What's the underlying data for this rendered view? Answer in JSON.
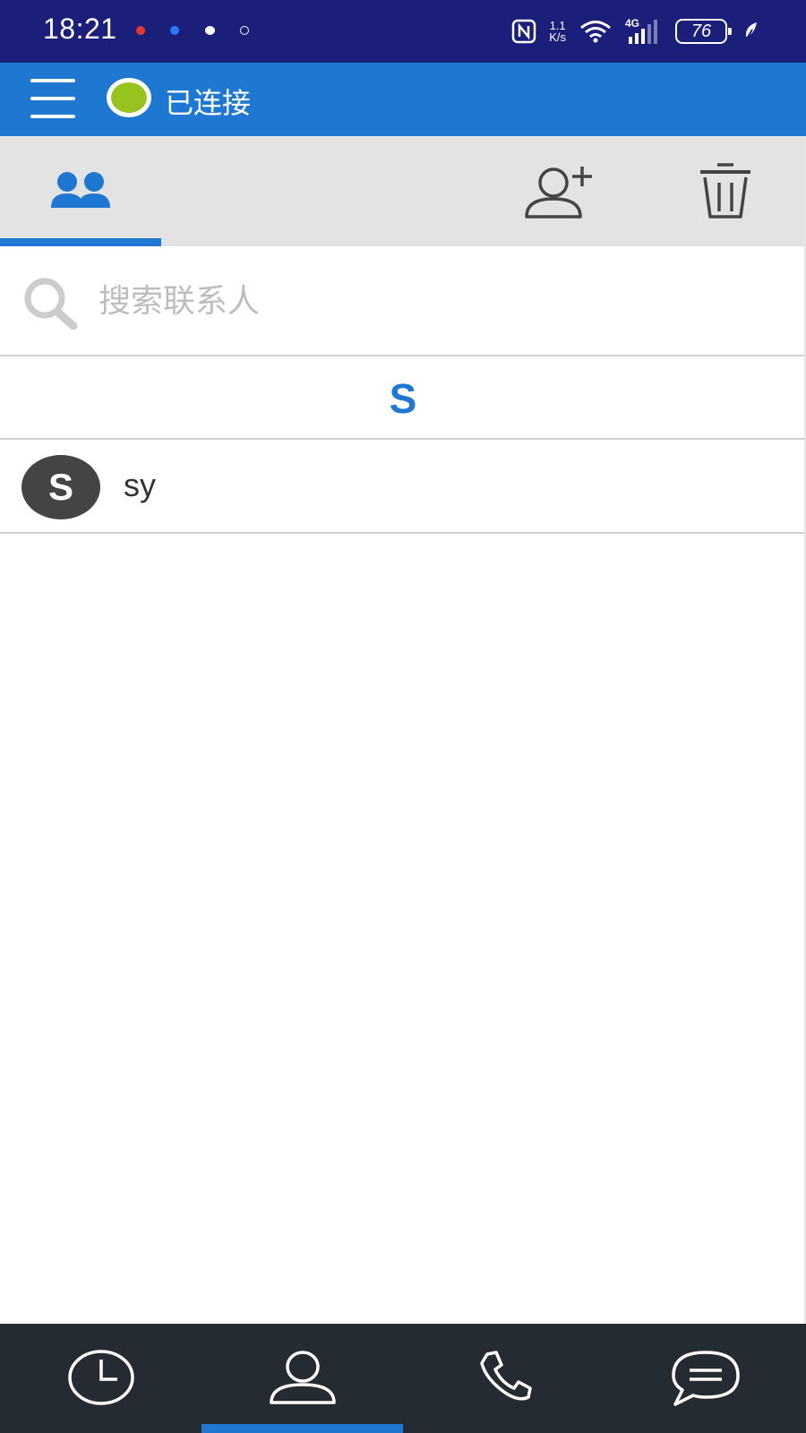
{
  "status_bar": {
    "time": "18:21",
    "network_speed_value": "1.1",
    "network_speed_unit": "K/s",
    "network_type": "4G",
    "battery_level": "76"
  },
  "app_bar": {
    "connection_status": "已连接",
    "connection_color": "#98c21e"
  },
  "toolbar": {
    "active_tab_icon": "contacts-group-icon",
    "add_contact_icon": "add-user-icon",
    "delete_icon": "trash-icon"
  },
  "search": {
    "placeholder": "搜索联系人",
    "value": ""
  },
  "contacts": {
    "sections": [
      {
        "letter": "S",
        "items": [
          {
            "initial": "S",
            "name": "sy"
          }
        ]
      }
    ]
  },
  "bottom_nav": {
    "items": [
      {
        "icon": "clock-icon",
        "active": false
      },
      {
        "icon": "person-icon",
        "active": true
      },
      {
        "icon": "phone-icon",
        "active": false
      },
      {
        "icon": "chat-icon",
        "active": false
      }
    ],
    "active_color": "#1e78d2"
  }
}
